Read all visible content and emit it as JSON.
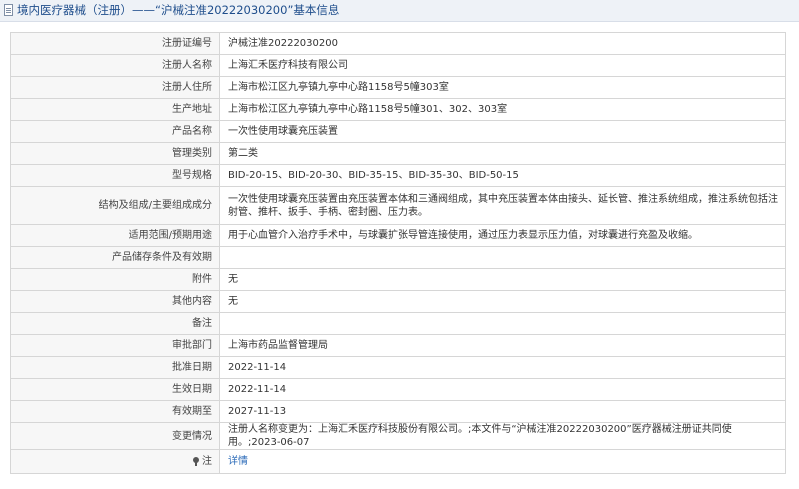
{
  "header": {
    "title": "境内医疗器械（注册）——“沪械注准20222030200”基本信息",
    "icon": "document-icon"
  },
  "rows": [
    {
      "label": "注册证编号",
      "value": "沪械注准20222030200"
    },
    {
      "label": "注册人名称",
      "value": "上海汇禾医疗科技有限公司"
    },
    {
      "label": "注册人住所",
      "value": "上海市松江区九亭镇九亭中心路1158号5幢303室"
    },
    {
      "label": "生产地址",
      "value": "上海市松江区九亭镇九亭中心路1158号5幢301、302、303室"
    },
    {
      "label": "产品名称",
      "value": "一次性使用球囊充压装置"
    },
    {
      "label": "管理类别",
      "value": "第二类"
    },
    {
      "label": "型号规格",
      "value": "BID-20-15、BID-20-30、BID-35-15、BID-35-30、BID-50-15"
    },
    {
      "label": "结构及组成/主要组成成分",
      "value": "一次性使用球囊充压装置由充压装置本体和三通阀组成，其中充压装置本体由接头、延长管、推注系统组成，推注系统包括注射管、推杆、扳手、手柄、密封圈、压力表。"
    },
    {
      "label": "适用范围/预期用途",
      "value": "用于心血管介入治疗手术中，与球囊扩张导管连接使用，通过压力表显示压力值，对球囊进行充盈及收缩。"
    },
    {
      "label": "产品储存条件及有效期",
      "value": ""
    },
    {
      "label": "附件",
      "value": "无"
    },
    {
      "label": "其他内容",
      "value": "无"
    },
    {
      "label": "备注",
      "value": ""
    },
    {
      "label": "审批部门",
      "value": "上海市药品监督管理局"
    },
    {
      "label": "批准日期",
      "value": "2022-11-14"
    },
    {
      "label": "生效日期",
      "value": "2022-11-14"
    },
    {
      "label": "有效期至",
      "value": "2027-11-13"
    },
    {
      "label": "变更情况",
      "value": "注册人名称变更为：上海汇禾医疗科技股份有限公司。;本文件与“沪械注准20222030200”医疗器械注册证共同使用。;2023-06-07"
    }
  ],
  "note_row": {
    "label": "注",
    "icon": "pin-icon",
    "link_text": "详情"
  }
}
